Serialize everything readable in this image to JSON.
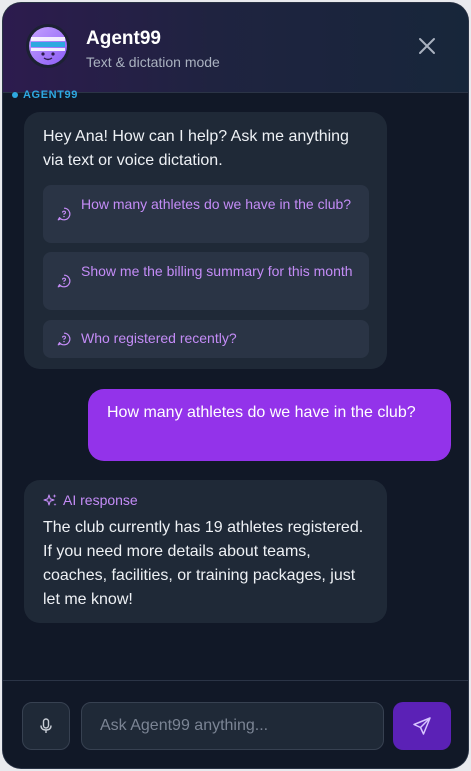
{
  "header": {
    "title": "Agent99",
    "subtitle": "Text & dictation mode",
    "avatar_icon": "robot-avatar-icon",
    "close_icon": "close-icon"
  },
  "agent_label": "AGENT99",
  "greeting": {
    "text": "Hey Ana! How can I help? Ask me anything via text or voice dictation.",
    "suggestions": [
      "How many athletes do we have in the club?",
      "Show me the billing summary for this month",
      "Who registered recently?"
    ]
  },
  "user_message": "How many athletes do we have in the club?",
  "response": {
    "label": "AI response",
    "text": "The club currently has 19 athletes registered. If you need more details about teams, coaches, facilities, or training packages, just let me know!"
  },
  "footer": {
    "input_placeholder": "Ask Agent99 anything...",
    "input_value": "",
    "mic_icon": "microphone-icon",
    "send_icon": "send-icon"
  },
  "colors": {
    "panel_bg": "#111827",
    "bubble_bg": "#1f2937",
    "accent_purple": "#9333ea",
    "suggestion_text": "#c48cf7",
    "agent_label": "#2ea8e0",
    "send_button": "#5b21b6"
  }
}
